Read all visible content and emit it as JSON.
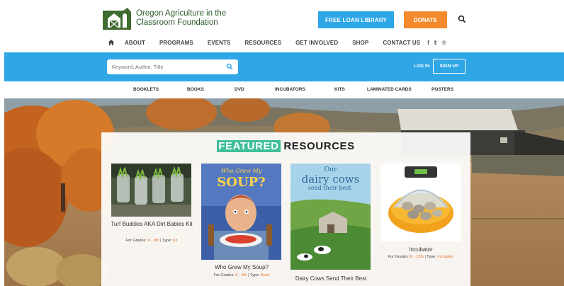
{
  "brand": {
    "line1": "Oregon Agriculture in the",
    "line2": "Classroom Foundation"
  },
  "header": {
    "loan_button": "FREE LOAN LIBRARY",
    "donate_button": "DONATE"
  },
  "nav": {
    "items": [
      "ABOUT",
      "PROGRAMS",
      "EVENTS",
      "RESOURCES",
      "GET INVOLVED",
      "SHOP",
      "CONTACT US"
    ],
    "social": [
      "f",
      "𝕥",
      "℗"
    ]
  },
  "searchbar": {
    "placeholder": "Keyword, Author, Title",
    "login": "LOG IN",
    "signup": "SIGN UP"
  },
  "categories": [
    "BOOKLETS",
    "BOOKS",
    "DVD",
    "INCUBATORS",
    "KITS",
    "LAMINATED CARDS",
    "POSTERS"
  ],
  "featured": {
    "highlight": "FEATURED",
    "rest": " RESOURCES",
    "items": [
      {
        "title": "Turf Buddies AKA Dirt Babies Kit",
        "grades_label": "For Grades:",
        "grades": "K - 8th",
        "type_label": "| Type:",
        "type": "Kit"
      },
      {
        "title": "Who Grew My Soup?",
        "grades_label": "For Grades:",
        "grades": "K - 4th",
        "type_label": "| Type:",
        "type": "Book",
        "cover_line1": "Who Grew My",
        "cover_line2": "SOUP?"
      },
      {
        "title": "Dairy Cows Send Their Best",
        "grades_label": "",
        "grades": "",
        "type_label": "",
        "type": "",
        "cover_line1": "Our",
        "cover_line2": "dairy cows",
        "cover_line3": "send their best."
      },
      {
        "title": "Incubator",
        "grades_label": "For Grades:",
        "grades": "K - 12th",
        "type_label": "| Type:",
        "type": "Incubator"
      }
    ]
  },
  "colors": {
    "blue": "#2fa6e6",
    "orange": "#f48a2c",
    "teal_highlight": "#3fbf9a",
    "brand_green": "#2d5d2a"
  },
  "icons": [
    "barn-logo-icon",
    "search-icon",
    "home-icon",
    "facebook-icon",
    "twitter-icon",
    "pinterest-icon"
  ]
}
